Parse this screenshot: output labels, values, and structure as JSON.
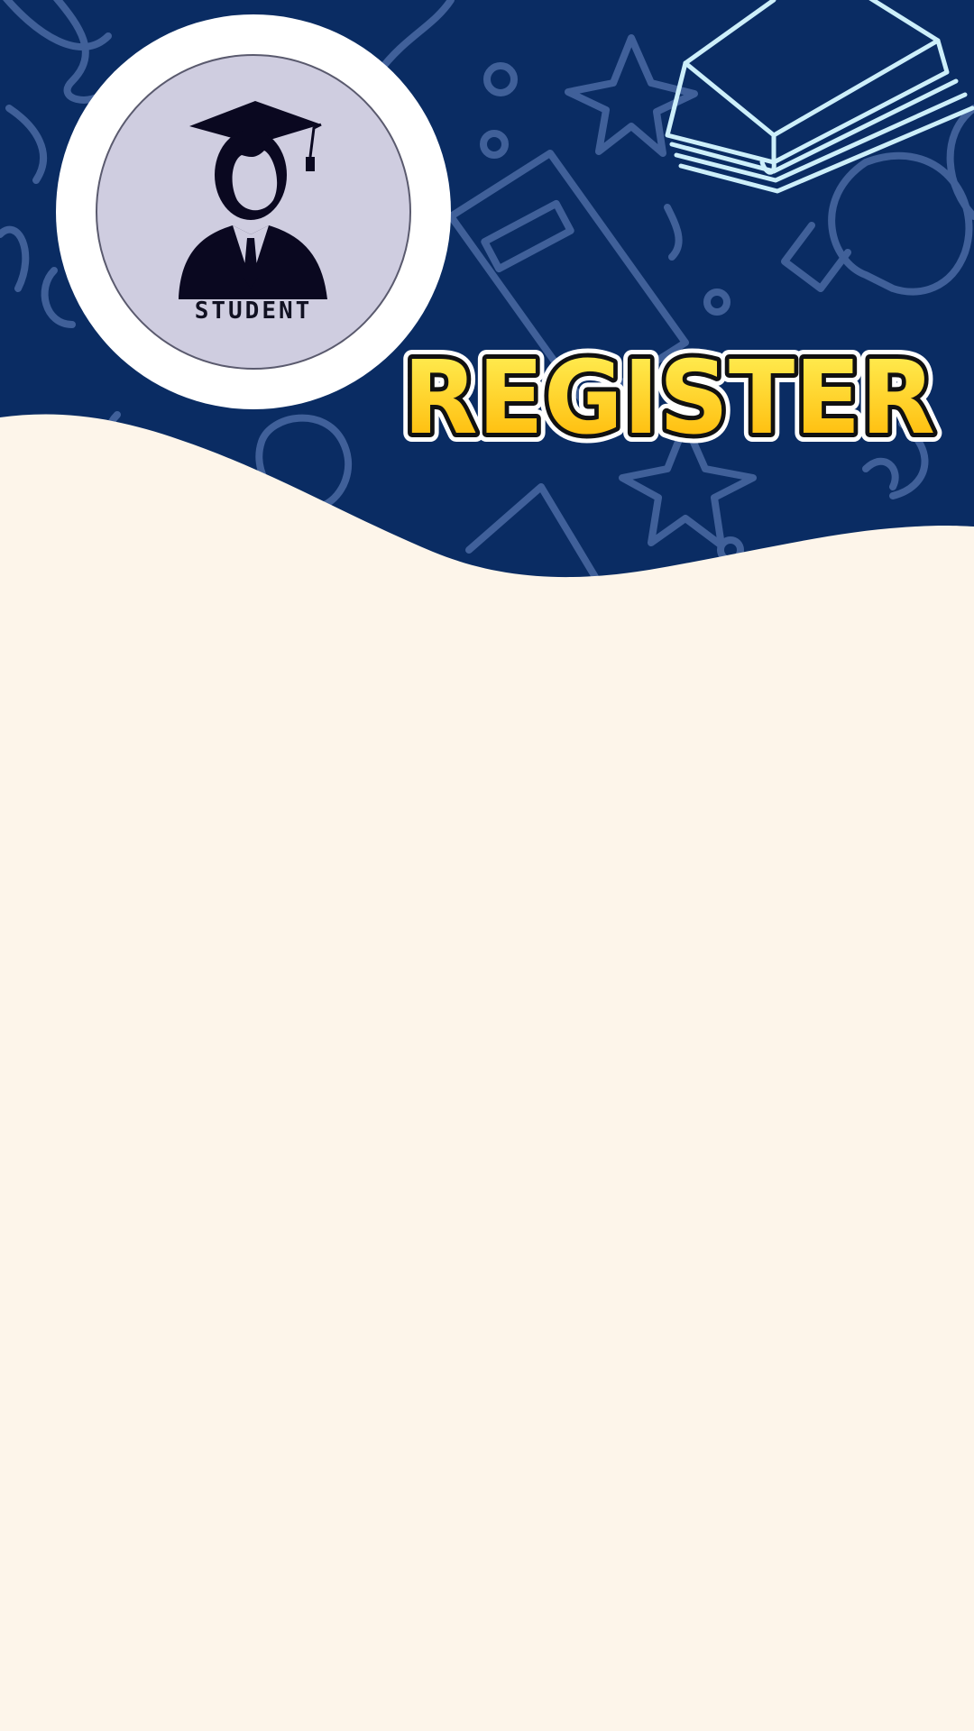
{
  "colors": {
    "header_navy": "#0a2c63",
    "doodle_line": "#4a6aa3",
    "book_doodle": "#cdeffa",
    "content_bg": "#fdf5ea",
    "title_fill_top": "#fff35a",
    "title_fill_bottom": "#ffb400",
    "avatar_disc": "#cfcde0",
    "avatar_ring": "#ffffff"
  },
  "header": {
    "title": "REGISTER",
    "avatar": {
      "icon": "graduate-student-icon",
      "caption": "STUDENT"
    }
  },
  "decor": {
    "icons": [
      "open-book-icon",
      "star-icon",
      "lightbulb-icon",
      "notebook-icon"
    ]
  }
}
